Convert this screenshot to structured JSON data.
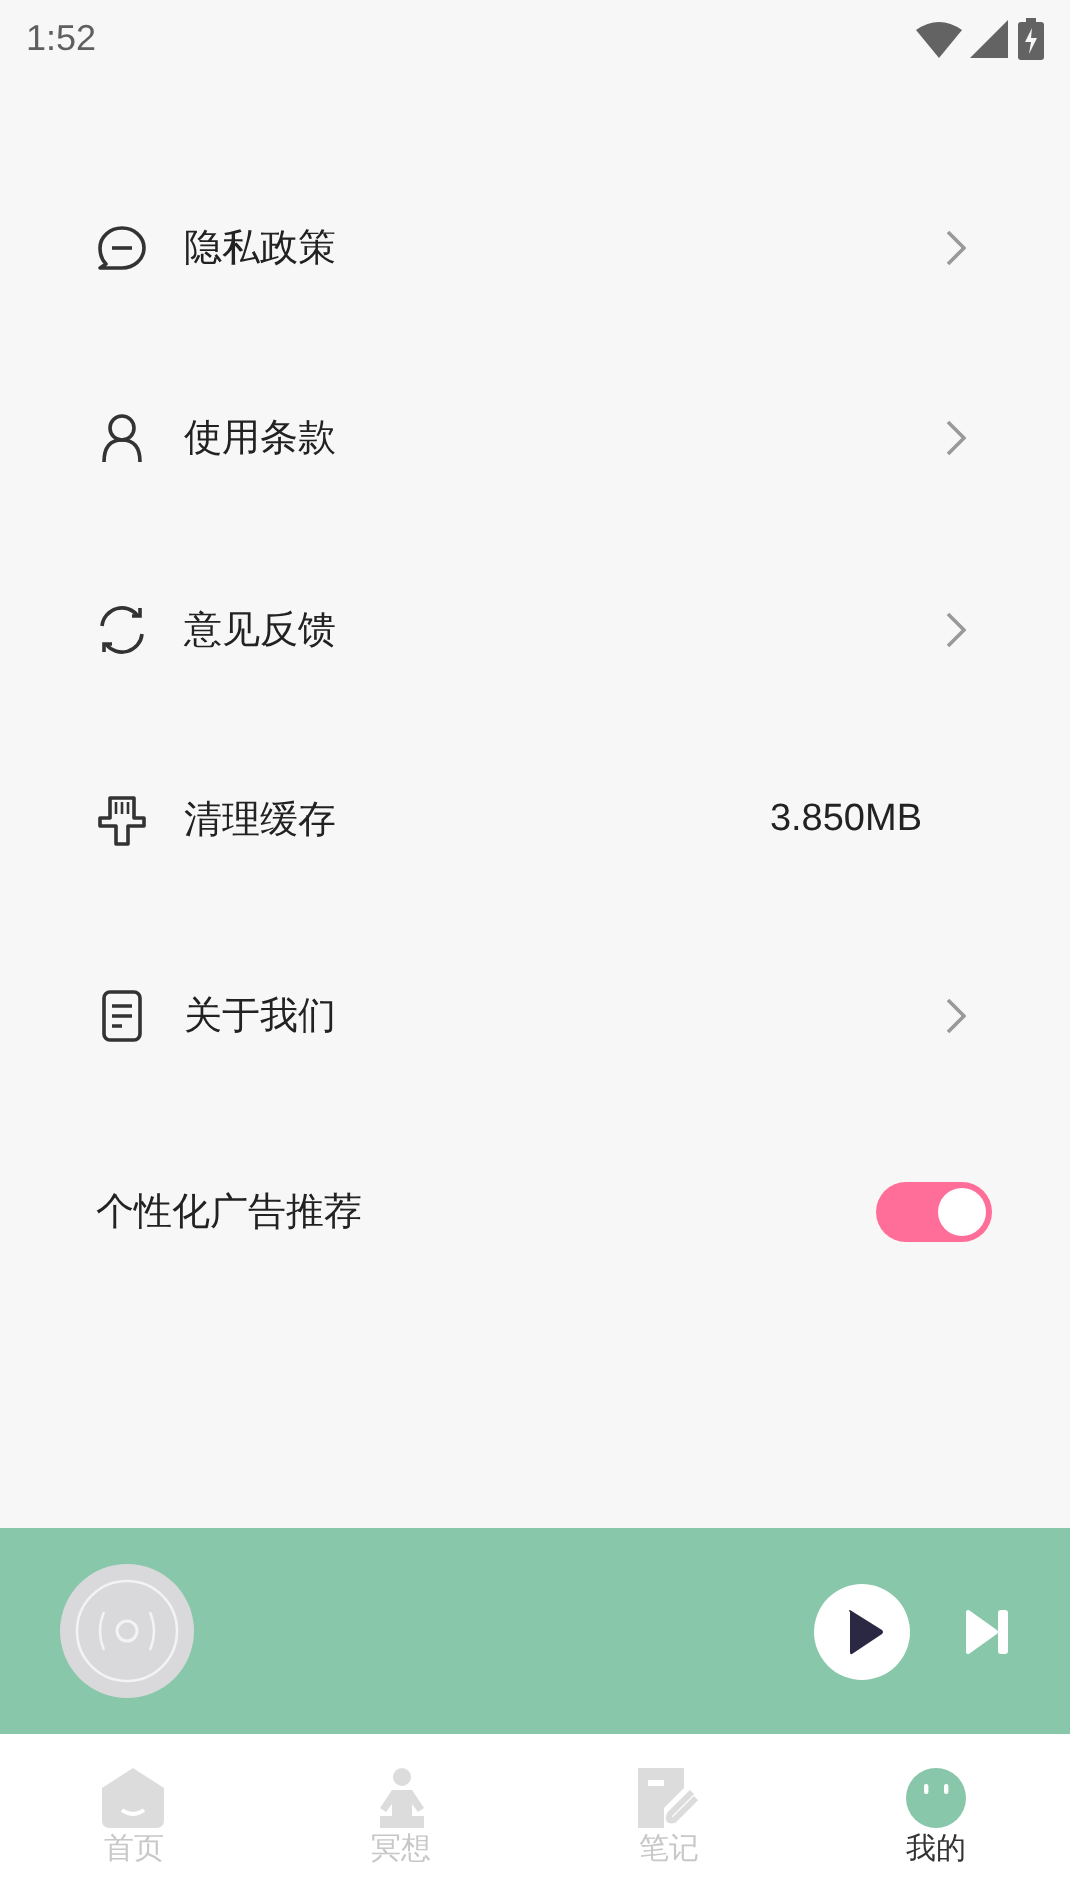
{
  "status_bar": {
    "time": "1:52"
  },
  "settings": [
    {
      "kind": "link",
      "label": "隐私政策"
    },
    {
      "kind": "link",
      "label": "使用条款"
    },
    {
      "kind": "link",
      "label": "意见反馈"
    },
    {
      "kind": "value",
      "label": "清理缓存",
      "value": "3.850MB"
    },
    {
      "kind": "link",
      "label": "关于我们"
    },
    {
      "kind": "toggle",
      "label": "个性化广告推荐",
      "on": true
    }
  ],
  "tabs": [
    {
      "label": "首页",
      "selected": false
    },
    {
      "label": "冥想",
      "selected": false
    },
    {
      "label": "笔记",
      "selected": false
    },
    {
      "label": "我的",
      "selected": true
    }
  ]
}
